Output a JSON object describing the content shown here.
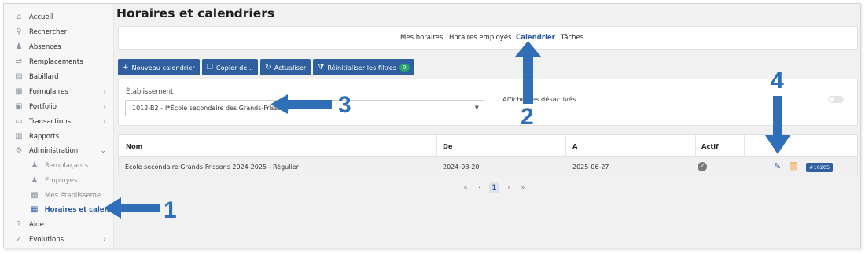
{
  "app": {
    "title": "Horaires et calendriers"
  },
  "sidebar": {
    "items": [
      {
        "label": "Accueil",
        "icon": "home-icon",
        "glyph": "⌂"
      },
      {
        "label": "Rechercher",
        "icon": "search-icon",
        "glyph": "⚲"
      },
      {
        "label": "Absences",
        "icon": "user-absence-icon",
        "glyph": "♟"
      },
      {
        "label": "Remplacements",
        "icon": "swap-icon",
        "glyph": "⇄"
      },
      {
        "label": "Babillard",
        "icon": "board-icon",
        "glyph": "▤"
      },
      {
        "label": "Formulaires",
        "icon": "form-icon",
        "glyph": "▦"
      },
      {
        "label": "Portfolio",
        "icon": "portfolio-icon",
        "glyph": "▣"
      },
      {
        "label": "Transactions",
        "icon": "transactions-icon",
        "glyph": "▭"
      },
      {
        "label": "Rapports",
        "icon": "report-icon",
        "glyph": "▥"
      },
      {
        "label": "Administration",
        "icon": "gear-icon",
        "glyph": "⚙"
      },
      {
        "label": "Remplaçants",
        "icon": "substitute-icon",
        "glyph": "♟"
      },
      {
        "label": "Employés",
        "icon": "employees-icon",
        "glyph": "♟"
      },
      {
        "label": "Mes établisseme...",
        "icon": "building-icon",
        "glyph": "▦"
      },
      {
        "label": "Horaires et calen...",
        "icon": "calendar-icon",
        "glyph": "▦"
      },
      {
        "label": "Aide",
        "icon": "help-icon",
        "glyph": "?"
      },
      {
        "label": "Évolutions",
        "icon": "evolution-icon",
        "glyph": "✓"
      }
    ]
  },
  "tabs": [
    {
      "label": "Mes horaires"
    },
    {
      "label": "Horaires employés"
    },
    {
      "label": "Calendrier"
    },
    {
      "label": "Tâches"
    }
  ],
  "toolbar": {
    "new_label": "Nouveau calendrier",
    "copy_label": "Copier de...",
    "refresh_label": "Actualiser",
    "reset_label": "Réinitialiser les filtres",
    "reset_count": "0"
  },
  "filters": {
    "etablissement_label": "Établissement",
    "etablissement_value": "1012-B2 - !*École secondaire des Grands-Frissons",
    "toggle_label": "Afficher les désactivés"
  },
  "table": {
    "headers": [
      "Nom",
      "De",
      "A",
      "Actif"
    ],
    "rows": [
      {
        "nom": "École secondaire Grands-Frissons 2024-2025 - Régulier",
        "de": "2024-08-20",
        "a": "2025-06-27",
        "id": "#10205"
      }
    ]
  },
  "pagination": {
    "first": "«",
    "prev": "‹",
    "current": "1",
    "next": "›",
    "last": "»"
  },
  "annotations": {
    "n1": "1",
    "n2": "2",
    "n3": "3",
    "n4": "4",
    "color": "#2e6fb7"
  }
}
